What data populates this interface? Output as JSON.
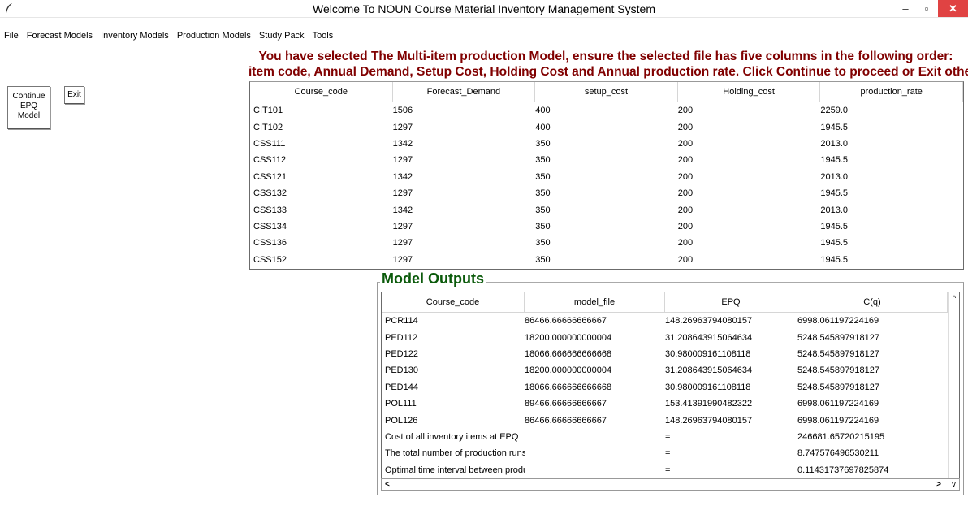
{
  "window": {
    "title": "Welcome To NOUN Course Material Inventory Management System",
    "minimize": "–",
    "maximize": "▫",
    "close": "✕"
  },
  "menu": [
    "File",
    "Forecast Models",
    "Inventory Models",
    "Production Models",
    "Study Pack",
    "Tools"
  ],
  "buttons": {
    "continue_line1": "Continue",
    "continue_line2": "EPQ",
    "continue_line3": "Model",
    "exit": "Exit"
  },
  "instructions": {
    "line1": "You have selected The Multi-item production Model, ensure the selected file has five columns in the following order:",
    "line2": "item code, Annual Demand, Setup Cost, Holding Cost and Annual production rate.  Click Continue to proceed or Exit otherwise"
  },
  "input_table": {
    "headers": [
      "Course_code",
      "Forecast_Demand",
      "setup_cost",
      "Holding_cost",
      "production_rate"
    ],
    "rows": [
      [
        "CIT101",
        "1506",
        "400",
        "200",
        "2259.0"
      ],
      [
        "CIT102",
        "1297",
        "400",
        "200",
        "1945.5"
      ],
      [
        "CSS111",
        "1342",
        "350",
        "200",
        "2013.0"
      ],
      [
        "CSS112",
        "1297",
        "350",
        "200",
        "1945.5"
      ],
      [
        "CSS121",
        "1342",
        "350",
        "200",
        "2013.0"
      ],
      [
        "CSS132",
        "1297",
        "350",
        "200",
        "1945.5"
      ],
      [
        "CSS133",
        "1342",
        "350",
        "200",
        "2013.0"
      ],
      [
        "CSS134",
        "1297",
        "350",
        "200",
        "1945.5"
      ],
      [
        "CSS136",
        "1297",
        "350",
        "200",
        "1945.5"
      ],
      [
        "CSS152",
        "1297",
        "350",
        "200",
        "1945.5"
      ]
    ]
  },
  "outputs": {
    "group_label": "Model Outputs",
    "headers": [
      "Course_code",
      "model_file",
      "EPQ",
      "C(q)"
    ],
    "rows": [
      [
        "PCR114",
        "86466.66666666667",
        "148.26963794080157",
        "6998.061197224169"
      ],
      [
        "PED112",
        "18200.000000000004",
        "31.208643915064634",
        "5248.545897918127"
      ],
      [
        "PED122",
        "18066.666666666668",
        "30.980009161108118",
        "5248.545897918127"
      ],
      [
        "PED130",
        "18200.000000000004",
        "31.208643915064634",
        "5248.545897918127"
      ],
      [
        "PED144",
        "18066.666666666668",
        "30.980009161108118",
        "5248.545897918127"
      ],
      [
        "POL111",
        "89466.66666666667",
        "153.41391990482322",
        "6998.061197224169"
      ],
      [
        "POL126",
        "86466.66666666667",
        "148.26963794080157",
        "6998.061197224169"
      ],
      [
        "Cost of all inventory items at EPQ",
        "",
        "=",
        "246681.65720215195"
      ],
      [
        "The total number of production runs",
        "",
        "=",
        "8.747576496530211"
      ],
      [
        "Optimal time interval between produ",
        "",
        "=",
        "0.11431737697825874"
      ]
    ]
  },
  "scrollbar": {
    "up": "^",
    "left": "<",
    "right": ">",
    "down": "v"
  }
}
